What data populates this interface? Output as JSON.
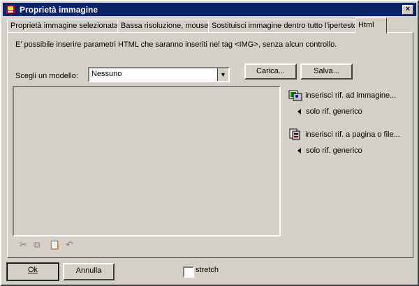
{
  "window": {
    "title": "Proprietà immagine",
    "close_glyph": "×"
  },
  "tabs": [
    {
      "label": "Proprietà immagine selezionata"
    },
    {
      "label": "Bassa risoluzione, mouse"
    },
    {
      "label": "Sostituisci immagine dentro tutto l'ipertesto"
    },
    {
      "label": "Html"
    }
  ],
  "html_tab": {
    "description": "E' possibile inserire  parametri HTML che saranno inseriti nel tag <IMG>, senza alcun controllo.",
    "model_label": "Scegli un modello:",
    "model_value": "Nessuno",
    "load_button": "Carica...",
    "save_button": "Salva...",
    "textarea_value": "",
    "insert_image_ref": "inserisci rif. ad immagine...",
    "generic_ref_1": "solo rif. generico",
    "insert_page_ref": "inserisci rif. a pagina o file...",
    "generic_ref_2": "solo rif. generico"
  },
  "footer": {
    "ok_button": "Ok",
    "cancel_button": "Annulla",
    "stretch_label": "stretch"
  },
  "icons": [
    "app-icon",
    "close-icon",
    "image-ref-icon",
    "page-ref-icon",
    "cut-icon",
    "copy-icon",
    "paste-icon",
    "undo-icon"
  ]
}
